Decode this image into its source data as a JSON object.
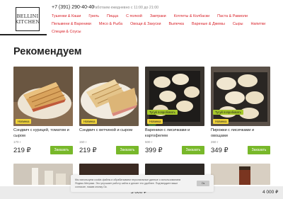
{
  "logo": {
    "line1": "BELLINI",
    "line2": "KITCHEN"
  },
  "header": {
    "phone": "+7 (391) 290-40-40",
    "hours": "Работаем ежедневно с 11:00 до 21:00"
  },
  "nav": {
    "row1": [
      "Тушенки & Каши",
      "Гриль",
      "Пицца",
      "С полкой",
      "Завтраки",
      "Котлеты & Колбаски",
      "Паста & Равиоли"
    ],
    "row2": [
      "Пельмени & Вареники",
      "Мясо & Рыба",
      "Овощи & Закуски",
      "Выпечка",
      "Вареные & Джемы",
      "Сыры",
      "Напитки"
    ],
    "row3": [
      "Специи & Соусы"
    ]
  },
  "page": {
    "title": "Рекомендуем"
  },
  "products": [
    {
      "name": "Сэндвич с курицей, томатом и сыром",
      "weight": "170 г",
      "price": "219 ₽",
      "badge": "Новинка",
      "badge_spicy": "",
      "button": "Заказать"
    },
    {
      "name": "Сэндвич с ветчиной и сыром",
      "weight": "150 г",
      "price": "219 ₽",
      "badge": "Новинка",
      "badge_spicy": "",
      "button": "Заказать"
    },
    {
      "name": "Вареники с лисичками и картофелем",
      "weight": "500 г",
      "price": "399 ₽",
      "badge": "Новинка",
      "badge_spicy": "Тусуй попробовать",
      "button": "Заказать"
    },
    {
      "name": "Пирожки с лисичками и овощами",
      "weight": "260 г",
      "price": "349 ₽",
      "badge": "Новинка",
      "badge_spicy": "Тусуй попробовать",
      "button": "Заказать"
    }
  ],
  "cookie": {
    "text": "Мы используем cookie-файлы и обрабатываем персональные данные с использованием Яндекс.Метрики. Это улучшает работу сайта и делает его удобнее. Подтвердите ваше согласие, нажав кнопку Ок.",
    "ok": "Ок"
  },
  "bottom": {
    "price1": "3 000 ₽",
    "price2": "4 000 ₽"
  },
  "colors": {
    "accent": "#d9242b",
    "button": "#78b82a",
    "badge": "#f1d43a"
  }
}
